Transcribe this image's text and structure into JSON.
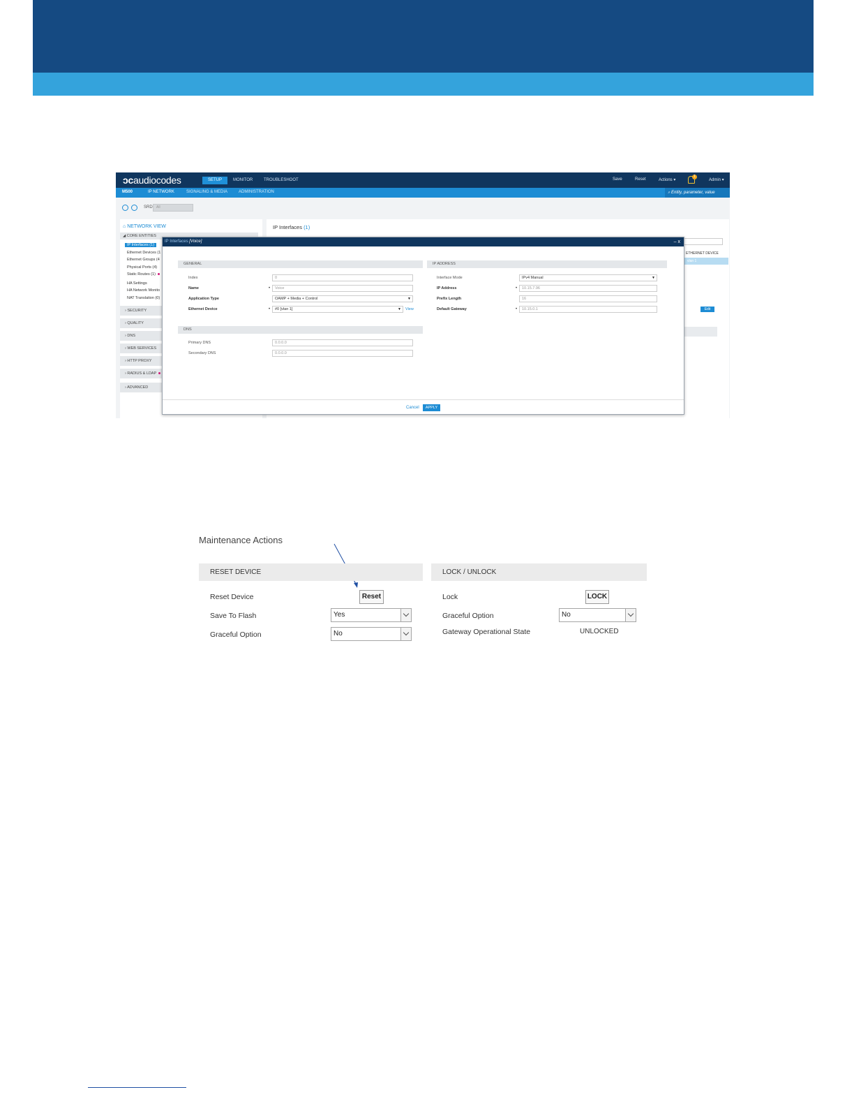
{
  "colors": {
    "header_dark": "#154a82",
    "header_light": "#34a3dc",
    "accent": "#1d8cd4",
    "nav_dark": "#10365e"
  },
  "app": {
    "logo": "audiocodes",
    "top_tabs": [
      "SETUP",
      "MONITOR",
      "TROUBLESHOOT"
    ],
    "top_right": {
      "save": "Save",
      "reset": "Reset",
      "actions": "Actions ▾",
      "admin": "Admin ▾",
      "bell_count": "1"
    },
    "device": "M500",
    "sub_tabs": [
      "IP NETWORK",
      "SIGNALING & MEDIA",
      "ADMINISTRATION"
    ],
    "search_placeholder": "Entity, parameter, value",
    "srd_label": "SRD",
    "srd_value": "All",
    "network_view": "NETWORK VIEW",
    "core_entities": "◢ CORE ENTITIES",
    "tree": [
      {
        "label": "IP Interfaces (1)"
      },
      {
        "label": "Ethernet Devices (1"
      },
      {
        "label": "Ethernet Groups (4"
      },
      {
        "label": "Physical Ports (4)"
      },
      {
        "label": "Static Routes (1)"
      },
      {
        "label": "HA Settings"
      },
      {
        "label": "HA Network Monito"
      },
      {
        "label": "NAT Translation (0)"
      }
    ],
    "sections": [
      "SECURITY",
      "QUALITY",
      "DNS",
      "WEB SERVICES",
      "HTTP PROXY",
      "RADIUS & LDAP",
      "ADVANCED"
    ],
    "page_title": "IP Interfaces",
    "page_count": "(1)",
    "eth_header": "ETHERNET DEVICE",
    "eth_value": "vlan 1",
    "edit": "Edit"
  },
  "modal": {
    "title_prefix": "IP Interfaces",
    "title_entity": "[Voice]",
    "controls": "–  x",
    "general": "GENERAL",
    "ip_address_section": "IP ADDRESS",
    "dns_section": "DNS",
    "fields": {
      "index": {
        "label": "Index",
        "value": "0"
      },
      "name": {
        "label": "Name",
        "value": "Voice"
      },
      "app_type": {
        "label": "Application Type",
        "value": "OAMP + Media + Control"
      },
      "eth_device": {
        "label": "Ethernet Device",
        "value": "#0 [vlan 1]",
        "link": "View"
      },
      "if_mode": {
        "label": "Interface Mode",
        "value": "IPv4 Manual"
      },
      "ip_addr": {
        "label": "IP Address",
        "value": "10.15.7.96"
      },
      "prefix": {
        "label": "Prefix Length",
        "value": "16"
      },
      "gateway": {
        "label": "Default Gateway",
        "value": "10.15.0.1"
      },
      "dns1": {
        "label": "Primary DNS",
        "value": "0.0.0.0"
      },
      "dns2": {
        "label": "Secondary DNS",
        "value": "0.0.0.0"
      }
    },
    "cancel": "Cancel",
    "apply": "APPLY"
  },
  "maintenance": {
    "title": "Maintenance Actions",
    "reset_panel": {
      "header": "RESET DEVICE",
      "reset_label": "Reset Device",
      "reset_button": "Reset",
      "save_label": "Save To Flash",
      "save_value": "Yes",
      "graceful_label": "Graceful Option",
      "graceful_value": "No"
    },
    "lock_panel": {
      "header": "LOCK / UNLOCK",
      "lock_label": "Lock",
      "lock_button": "LOCK",
      "graceful_label": "Graceful Option",
      "graceful_value": "No",
      "state_label": "Gateway Operational State",
      "state_value": "UNLOCKED"
    }
  }
}
